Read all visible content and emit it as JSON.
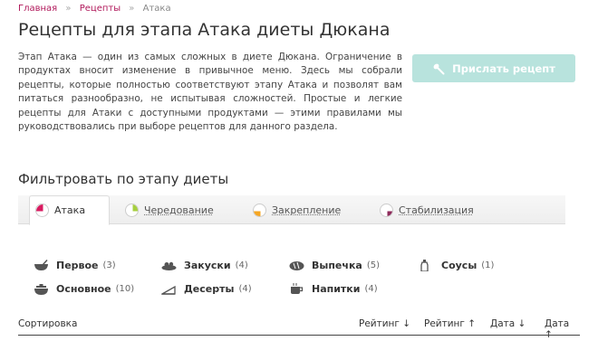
{
  "breadcrumb": {
    "items": [
      "Главная",
      "Рецепты"
    ],
    "separator": "»",
    "current": "Атака"
  },
  "page": {
    "title": "Рецепты для этапа Атака диеты Дюкана",
    "intro": "Этап Атака — один из самых сложных в диете Дюкана. Ограничение в продуктах вносит изменение в привычное меню. Здесь мы собрали рецепты, которые полностью соответствуют этапу Атака и позволят вам питаться разнообразно, не испытывая сложностей. Простые и легкие рецепты для Атаки с доступными продуктами — этими правилами мы руководствовались при выборе рецептов для данного раздела."
  },
  "submit_button": {
    "label": "Прислать рецепт",
    "icon": "spoon-icon",
    "color": "#b8e3dd"
  },
  "filter": {
    "heading": "Фильтровать по этапу диеты",
    "tabs": [
      {
        "label": "Атака",
        "active": true,
        "color": "#d81b60",
        "progress": 0.25
      },
      {
        "label": "Чередование",
        "active": false,
        "color": "#a6cf3e",
        "progress": 0.25
      },
      {
        "label": "Закрепление",
        "active": false,
        "color": "#f5a623",
        "progress": 0.25
      },
      {
        "label": "Стабилизация",
        "active": false,
        "color": "#8e2a5a",
        "progress": 0.25
      }
    ]
  },
  "categories": [
    {
      "name": "Первое",
      "count": "(3)",
      "icon": "soup-bowl-icon"
    },
    {
      "name": "Закуски",
      "count": "(4)",
      "icon": "snack-plate-icon"
    },
    {
      "name": "Выпечка",
      "count": "(5)",
      "icon": "bread-icon"
    },
    {
      "name": "Соусы",
      "count": "(1)",
      "icon": "sauce-bottle-icon"
    },
    {
      "name": "Основное",
      "count": "(10)",
      "icon": "main-dish-icon"
    },
    {
      "name": "Десерты",
      "count": "(4)",
      "icon": "cake-slice-icon"
    },
    {
      "name": "Напитки",
      "count": "(4)",
      "icon": "cup-icon"
    }
  ],
  "sorting": {
    "label": "Сортировка",
    "options": [
      "Рейтинг ↓",
      "Рейтинг ↑",
      "Дата ↓",
      "Дата ↑"
    ]
  }
}
